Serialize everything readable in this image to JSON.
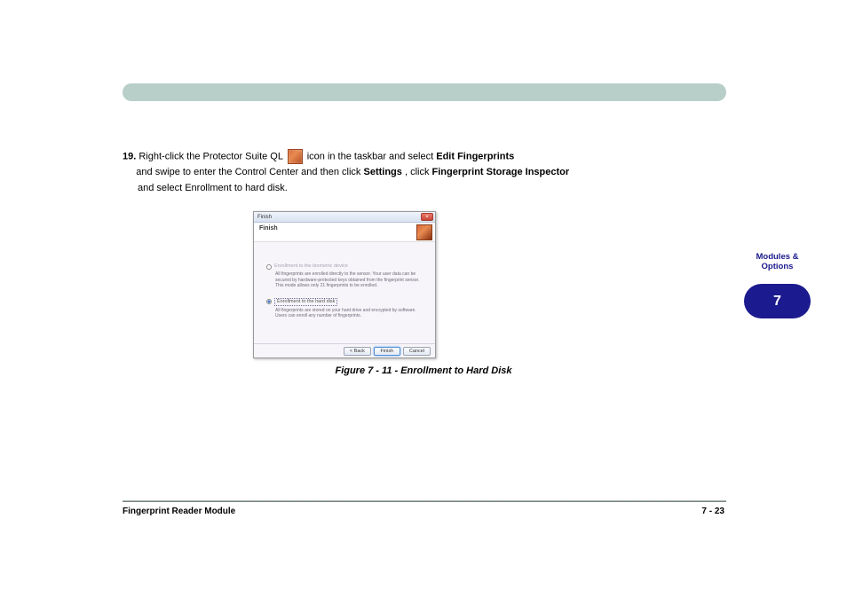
{
  "header": {
    "title": "  "
  },
  "body": {
    "step": "19.",
    "text_before_icon": "Right-click the Protector Suite QL",
    "text_after_icon": "  icon in the taskbar and select",
    "edit_fingerprints": "Edit Fingerprints",
    "line2": "and swipe to enter the Control Center and then click",
    "settings": "Settings",
    "settings_tail": ", click",
    "fp_storage": "Fingerprint Storage Inspector",
    "line3_tail": "and select Enrollment to hard disk."
  },
  "dialog": {
    "window_title": "Finish",
    "header_title": "Finish",
    "close_symbol": "×",
    "option1": "Enrollment to the biometric device",
    "option1_desc": "All fingerprints are enrolled directly to the sensor. Your user data can be secured by hardware-protected keys obtained from the fingerprint sensor. This mode allows only 21 fingerprints to be enrolled.",
    "option2": "Enrollment to the hard disk",
    "option2_desc": "All fingerprints are stored on your hard drive and encrypted by software. Users can enroll any number of fingerprints.",
    "btn_back": "< Back",
    "btn_finish": "Finish",
    "btn_cancel": "Cancel"
  },
  "figure_caption": "Figure 7 - 11 - Enrollment to Hard Disk",
  "side_tab": {
    "label_line1": "Modules &",
    "label_line2": "Options",
    "number": "7"
  },
  "footer": {
    "left": "Fingerprint Reader Module",
    "right": "7 - 23"
  }
}
